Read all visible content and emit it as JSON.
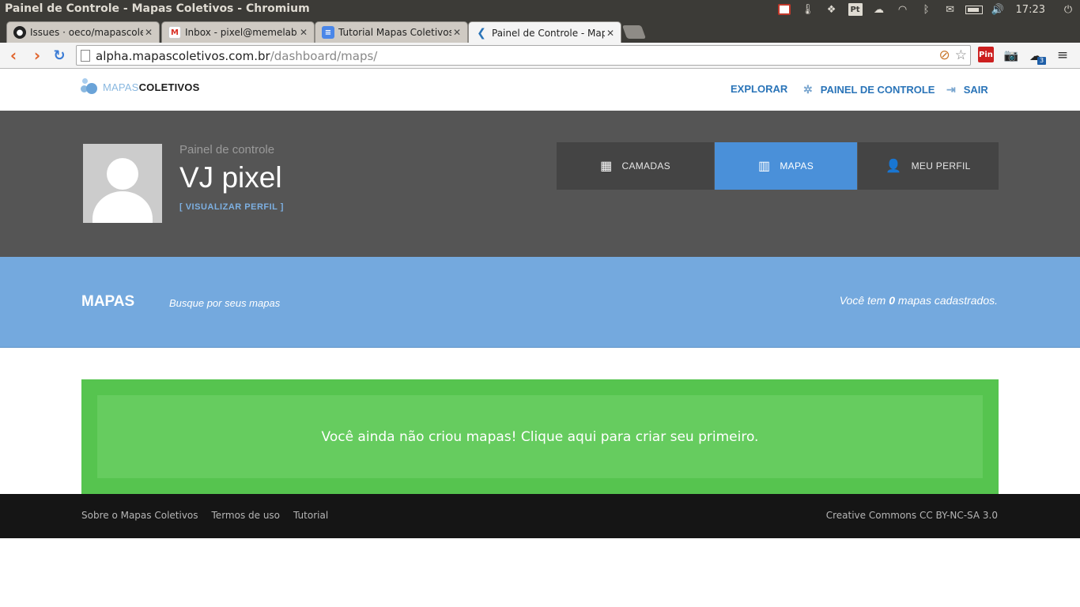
{
  "os": {
    "window_title": "Painel de Controle - Mapas Coletivos - Chromium",
    "time": "17:23"
  },
  "browser": {
    "tabs": [
      {
        "title": "Issues · oeco/mapascoletivos",
        "favicon": "github-icon",
        "active": false
      },
      {
        "title": "Inbox - pixel@memelab.com.br",
        "favicon": "gmail-icon",
        "active": false
      },
      {
        "title": "Tutorial Mapas Coletivos -",
        "favicon": "docs-icon",
        "active": false
      },
      {
        "title": "Painel de Controle - Mapas",
        "favicon": "mapas-icon",
        "active": true
      }
    ],
    "url_host": "alpha.mapascoletivos.com.br",
    "url_path": "/dashboard/maps/",
    "ext_pin_label": "Pin",
    "ext_cloud_badge": "3"
  },
  "site": {
    "logo_light": "MAPAS",
    "logo_bold": "COLETIVOS",
    "nav": {
      "explore": "EXPLORAR",
      "dashboard": "PAINEL DE CONTROLE",
      "logout": "SAIR"
    }
  },
  "hero": {
    "subtitle": "Painel de controle",
    "name": "VJ pixel",
    "view_profile": "[ VISUALIZAR PERFIL ]",
    "tabs": [
      {
        "label": "CAMADAS",
        "icon": "grid-icon",
        "active": false
      },
      {
        "label": "MAPAS",
        "icon": "map-icon",
        "active": true
      },
      {
        "label": "MEU PERFIL",
        "icon": "user-icon",
        "active": false
      }
    ]
  },
  "maps": {
    "title": "MAPAS",
    "search_placeholder": "Busque por seus mapas",
    "count_prefix": "Você tem",
    "count": "0",
    "count_suffix": "mapas cadastrados.",
    "empty_message": "Você ainda não criou mapas! Clique aqui para criar seu primeiro."
  },
  "footer": {
    "links": [
      "Sobre o Mapas Coletivos",
      "Termos de uso",
      "Tutorial"
    ],
    "license": "Creative Commons CC BY-NC-SA 3.0"
  },
  "colors": {
    "accent": "#4a90d9",
    "maps_bar": "#74a9de",
    "hero_bg": "#555555",
    "success": "#56c44f"
  }
}
